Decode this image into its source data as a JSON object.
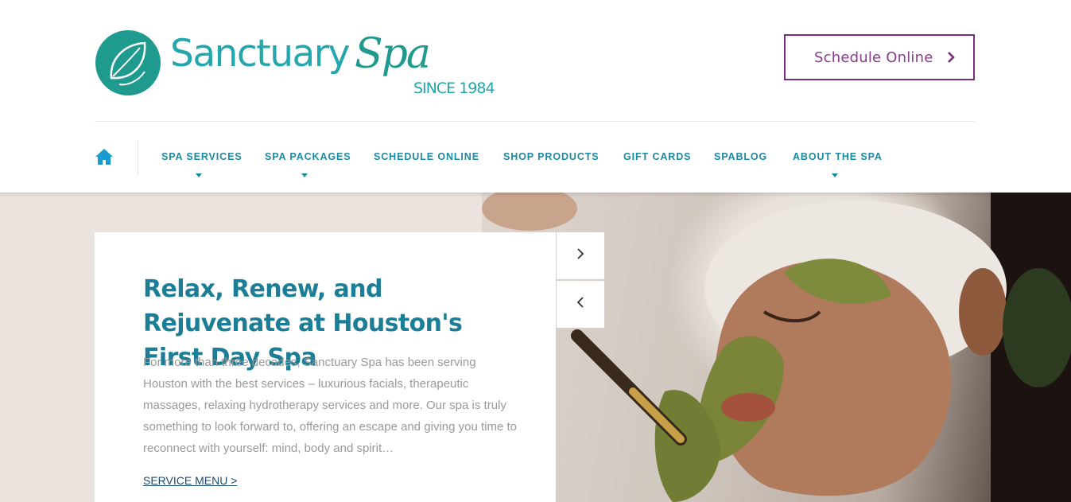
{
  "brand": {
    "name_word": "Sanctuary",
    "name_script": "Spa",
    "tagline": "SINCE 1984",
    "teal": "#1e9a8f",
    "plum": "#7a2c7e"
  },
  "header": {
    "schedule_label": "Schedule Online",
    "schedule_icon": "chevron-right-icon"
  },
  "nav": {
    "home_icon": "home-icon",
    "items": [
      {
        "label": "SPA SERVICES",
        "dropdown": true
      },
      {
        "label": "SPA PACKAGES",
        "dropdown": true
      },
      {
        "label": "SCHEDULE ONLINE",
        "dropdown": false
      },
      {
        "label": "SHOP PRODUCTS",
        "dropdown": false
      },
      {
        "label": "GIFT CARDS",
        "dropdown": false
      },
      {
        "label": "SPABLOG",
        "dropdown": false
      },
      {
        "label": "ABOUT THE SPA",
        "dropdown": true
      }
    ]
  },
  "hero": {
    "title": "Relax, Renew, and Rejuvenate at Houston's First Day Spa",
    "body": "For more than three decades, Sanctuary Spa has been serving Houston with the best services – luxurious facials, therapeutic massages, relaxing hydrotherapy services and more. Our spa is truly something to look forward to, offering an escape and giving you time to reconnect with yourself: mind, body and spirit…",
    "link": "SERVICE MENU >",
    "next_icon": "chevron-right-icon",
    "prev_icon": "chevron-left-icon"
  }
}
